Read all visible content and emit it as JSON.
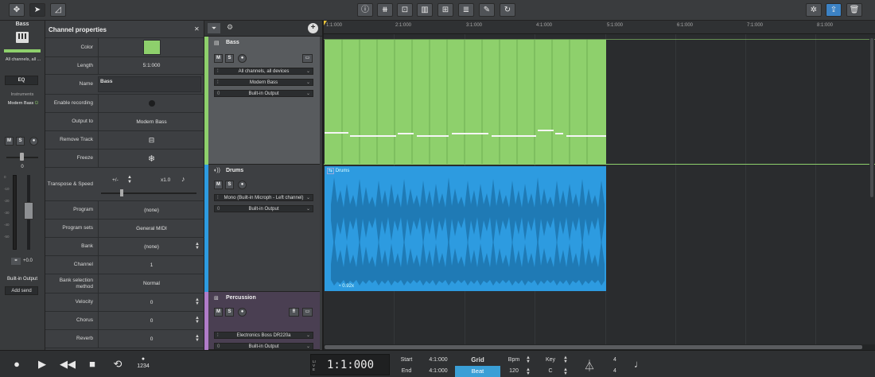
{
  "toolbar": {
    "move_icon": "move-icon",
    "pointer_icon": "pointer-icon",
    "automation_icon": "automation-icon",
    "center_icons": [
      "info-icon",
      "mixer-icon",
      "fx-icon",
      "keyboard-icon",
      "tuner-icon",
      "pen-icon",
      "loop-icon"
    ],
    "right_icons": [
      "ai-icon",
      "share-icon",
      "trash-icon"
    ]
  },
  "left_strip": {
    "track_name": "Bass",
    "channel_label": "All channels, all ...",
    "eq_label": "EQ",
    "instruments_label": "Instruments",
    "instrument_name": "Modern Bass",
    "mute": "M",
    "solo": "S",
    "pan_value": "0",
    "fader_scale": [
      "0",
      "-10",
      "-20",
      "-30",
      "-40",
      "-50",
      "-60"
    ],
    "gain_value": "+0.0",
    "output_label": "Built-in Output",
    "add_send_label": "Add send"
  },
  "props": {
    "title": "Channel properties",
    "close": "✕",
    "color": "#8ed06c",
    "rows": {
      "color": "Color",
      "length": "Length",
      "length_value": "5:1:000",
      "name": "Name",
      "name_value": "Bass",
      "enable_recording": "Enable recording",
      "output_to": "Output to",
      "output_value": "Modern Bass",
      "remove_track": "Remove Track",
      "freeze": "Freeze",
      "transpose": "Transpose & Speed",
      "transpose_pm": "+/-",
      "speed": "x1.0",
      "program": "Program",
      "program_value": "(none)",
      "program_sets": "Program sets",
      "program_sets_value": "General MIDI",
      "bank": "Bank",
      "bank_value": "(none)",
      "channel": "Channel",
      "channel_value": "1",
      "bank_selection": "Bank selection method",
      "bank_selection_value": "Normal",
      "velocity": "Velocity",
      "velocity_value": "0",
      "chorus": "Chorus",
      "chorus_value": "0",
      "reverb": "Reverb",
      "reverb_value": "0"
    }
  },
  "tracks": [
    {
      "name": "Bass",
      "color": "#8ed06c",
      "mute": "M",
      "solo": "S",
      "sel1": "All channels, all devices",
      "sel2": "Modern Bass",
      "sel3": "Built-in Output",
      "sel_index": "0"
    },
    {
      "name": "Drums",
      "color": "#2d9be0",
      "mute": "M",
      "solo": "S",
      "sel1": "Mono (Built-in Microph - Left channel)",
      "sel2": "Built-in Output",
      "sel_index": "0"
    },
    {
      "name": "Percussion",
      "color": "#b07cc8",
      "mute": "M",
      "solo": "S",
      "sel1": "Electronics Boss DR220a",
      "sel2": "Built-in Output",
      "sel_index": "0"
    }
  ],
  "ruler": [
    "1:1:000",
    "2:1:000",
    "3:1:000",
    "4:1:000",
    "5:1:000",
    "6:1:000",
    "7:1:000",
    "8:1:000"
  ],
  "clips": {
    "drums_label": "Drums",
    "drums_speed": "0.92x"
  },
  "transport": {
    "time": "1:1:000",
    "live": "LIVE",
    "start_label": "Start",
    "start_value": "4:1:000",
    "end_label": "End",
    "end_value": "4:1:000",
    "grid_label": "Grid",
    "grid_value": "Beat",
    "bpm_label": "Bpm",
    "bpm_value": "120",
    "key_label": "Key",
    "key_value": "C",
    "sig_top": "4",
    "sig_bottom": "4",
    "countin": "1234"
  }
}
